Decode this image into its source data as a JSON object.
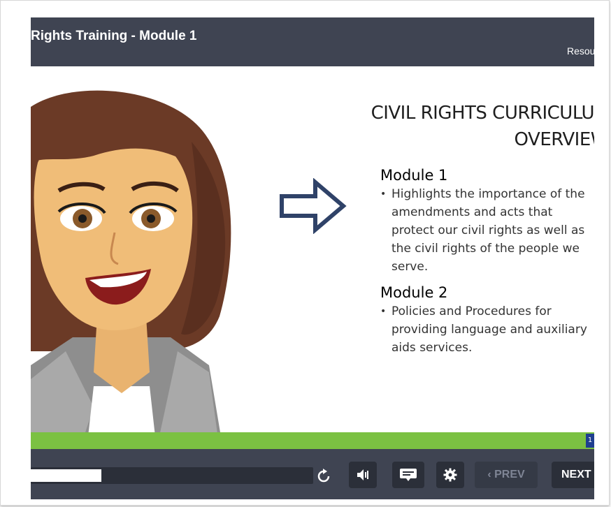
{
  "header": {
    "course_title": "Rights Training - Module 1",
    "resources_label": "Resou"
  },
  "slide": {
    "title_line1": "CIVIL RIGHTS CURRICULUM",
    "title_line2": "OVERVIEW",
    "modules": [
      {
        "heading": "Module 1",
        "bullet": "Highlights the importance of the amendments and acts that protect our civil rights as well as the civil rights of the people we serve."
      },
      {
        "heading": "Module 2",
        "bullet": "Policies and Procedures for providing language and auxiliary aids services."
      }
    ]
  },
  "player": {
    "seek_progress": 0.25,
    "prev_label": "PREV",
    "next_label": "NEXT",
    "badge_text": "1"
  },
  "icons": [
    "replay-icon",
    "volume-icon",
    "captions-icon",
    "gear-icon",
    "chevron-left-icon",
    "right-arrow-icon"
  ],
  "colors": {
    "bar_dark": "#3f4452",
    "control_dark": "#2b2f39",
    "progress_green": "#7bc142",
    "arrow_navy": "#2f4268"
  }
}
